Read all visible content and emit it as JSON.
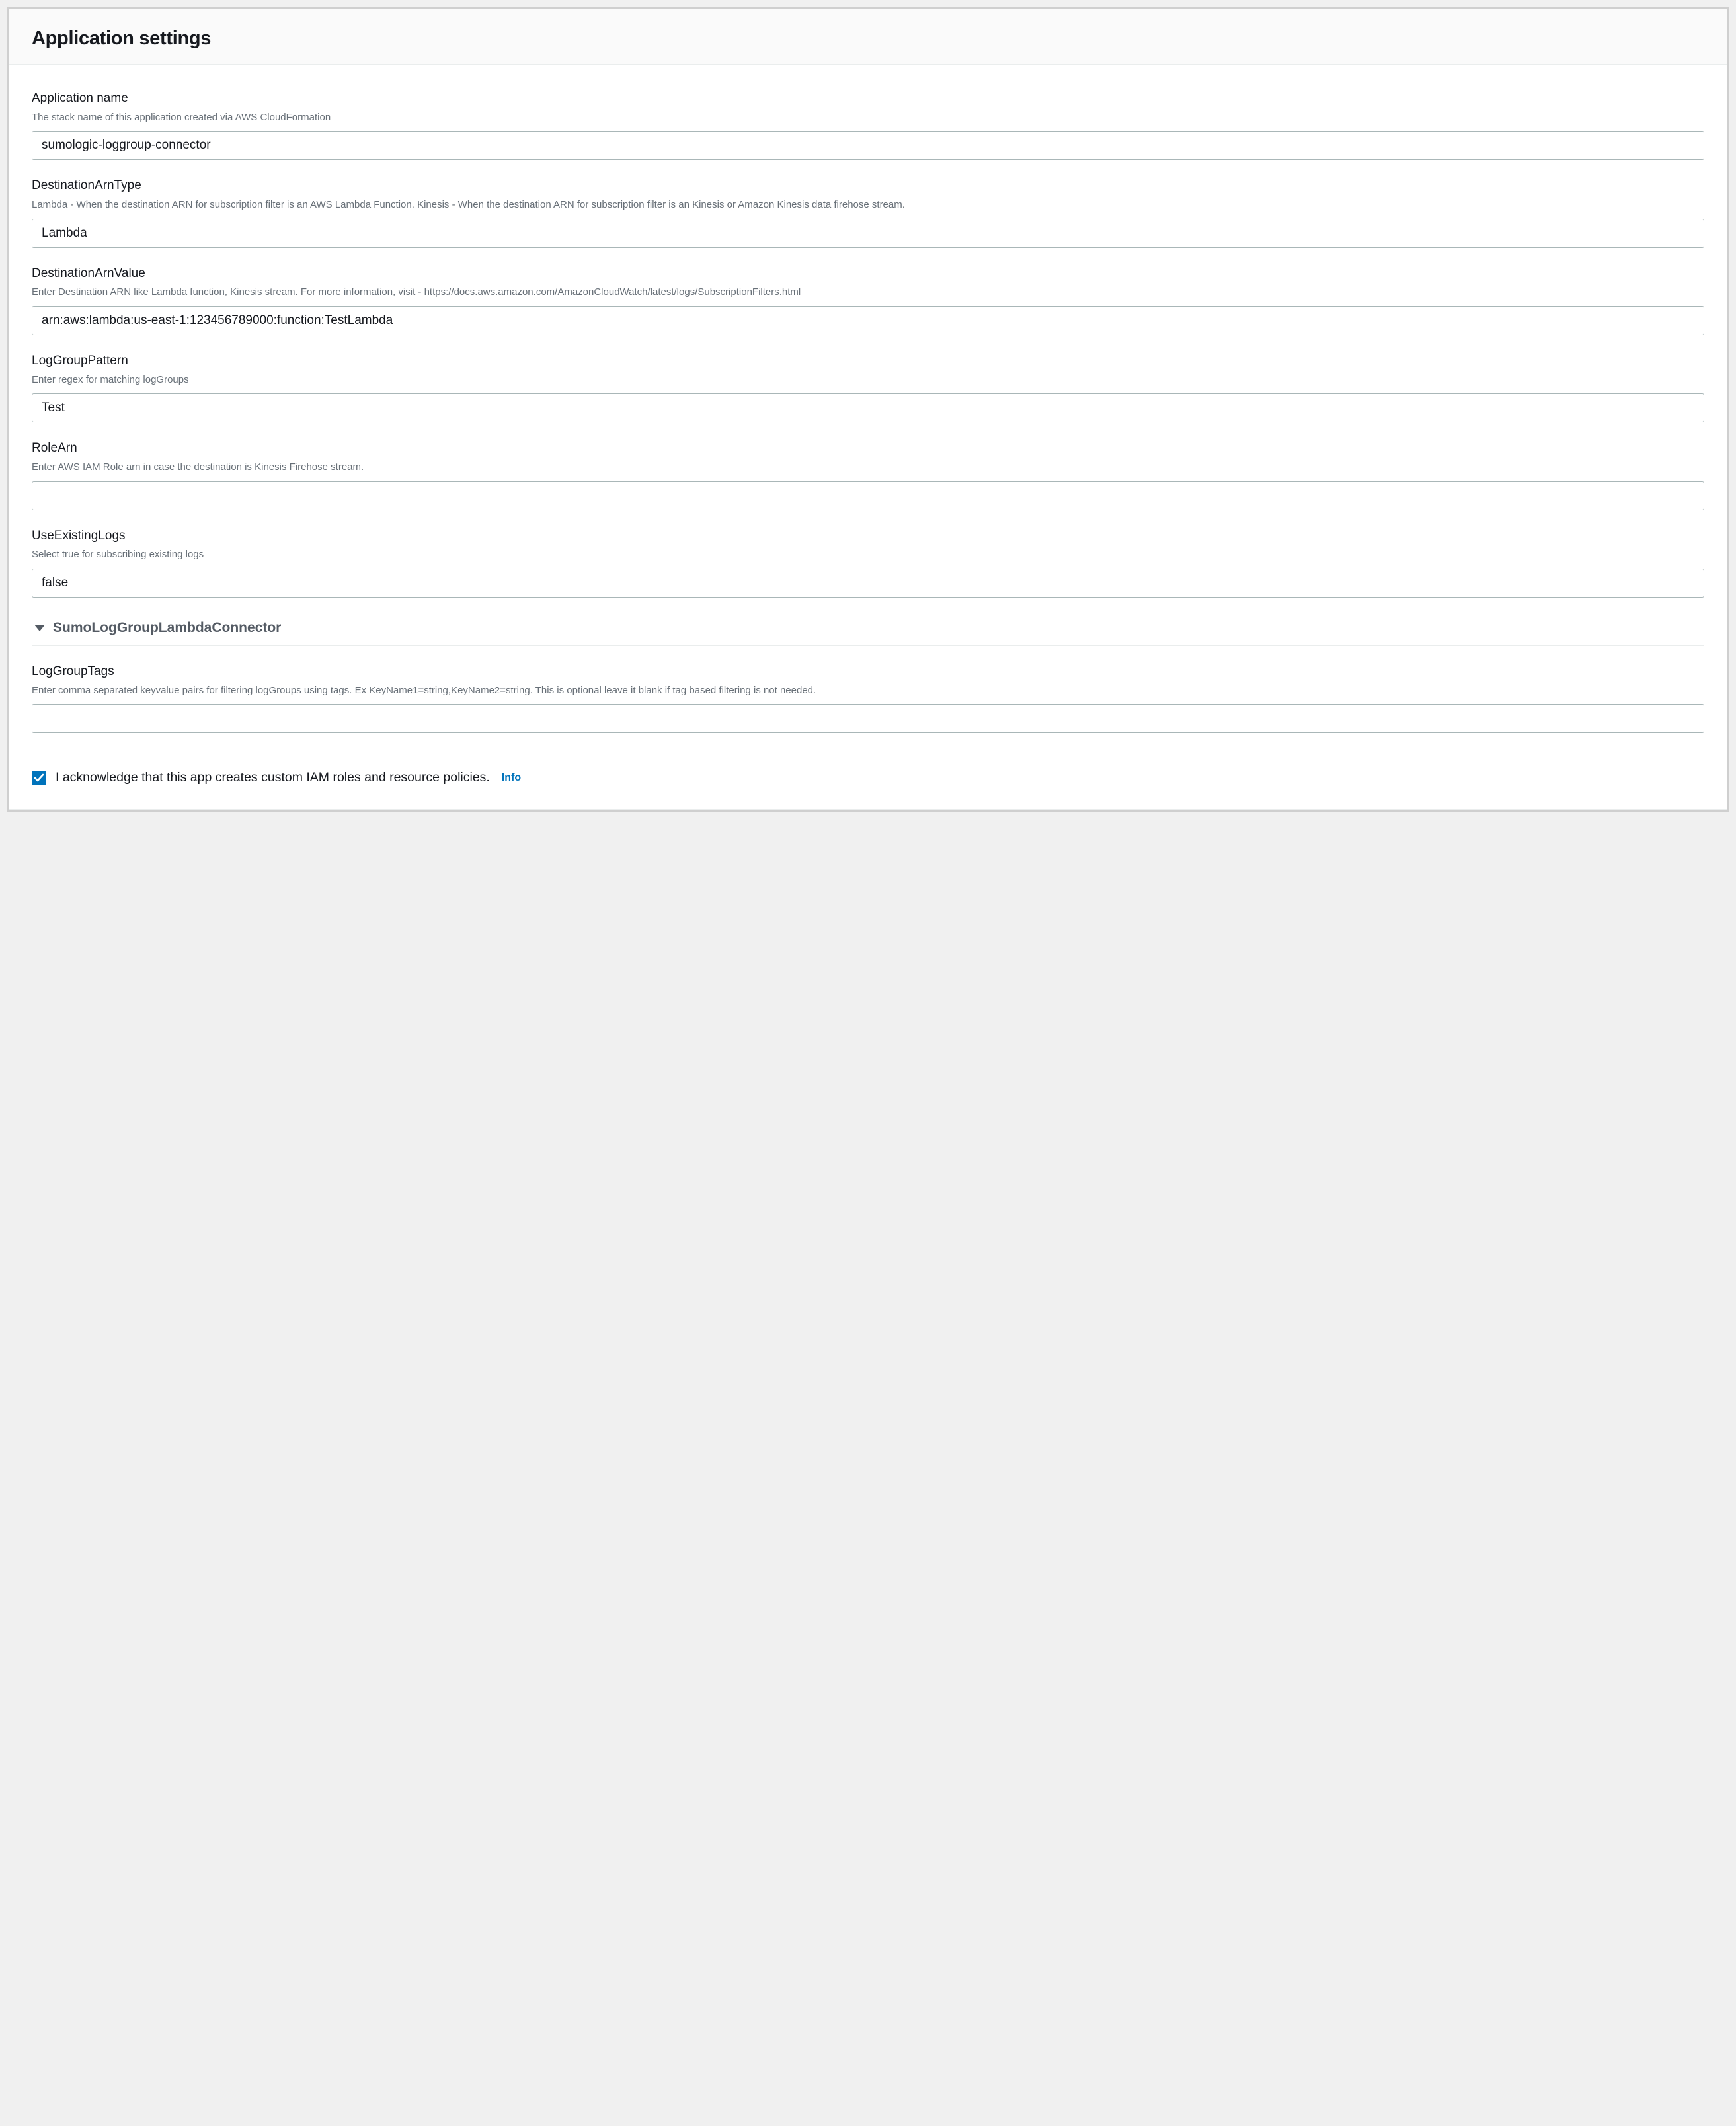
{
  "header": {
    "title": "Application settings"
  },
  "fields": {
    "appName": {
      "label": "Application name",
      "desc": "The stack name of this application created via AWS CloudFormation",
      "value": "sumologic-loggroup-connector"
    },
    "destArnType": {
      "label": "DestinationArnType",
      "desc": "Lambda - When the destination ARN for subscription filter is an AWS Lambda Function. Kinesis - When the destination ARN for subscription filter is an Kinesis or Amazon Kinesis data firehose stream.",
      "value": "Lambda"
    },
    "destArnValue": {
      "label": "DestinationArnValue",
      "desc": "Enter Destination ARN like Lambda function, Kinesis stream. For more information, visit - https://docs.aws.amazon.com/AmazonCloudWatch/latest/logs/SubscriptionFilters.html",
      "value": "arn:aws:lambda:us-east-1:123456789000:function:TestLambda"
    },
    "logGroupPattern": {
      "label": "LogGroupPattern",
      "desc": "Enter regex for matching logGroups",
      "value": "Test"
    },
    "roleArn": {
      "label": "RoleArn",
      "desc": "Enter AWS IAM Role arn in case the destination is Kinesis Firehose stream.",
      "value": ""
    },
    "useExistingLogs": {
      "label": "UseExistingLogs",
      "desc": "Select true for subscribing existing logs",
      "value": "false"
    },
    "logGroupTags": {
      "label": "LogGroupTags",
      "desc": "Enter comma separated keyvalue pairs for filtering logGroups using tags. Ex KeyName1=string,KeyName2=string. This is optional leave it blank if tag based filtering is not needed.",
      "value": ""
    }
  },
  "section": {
    "title": "SumoLogGroupLambdaConnector"
  },
  "ack": {
    "text": "I acknowledge that this app creates custom IAM roles and resource policies.",
    "info": "Info",
    "checked": true
  }
}
